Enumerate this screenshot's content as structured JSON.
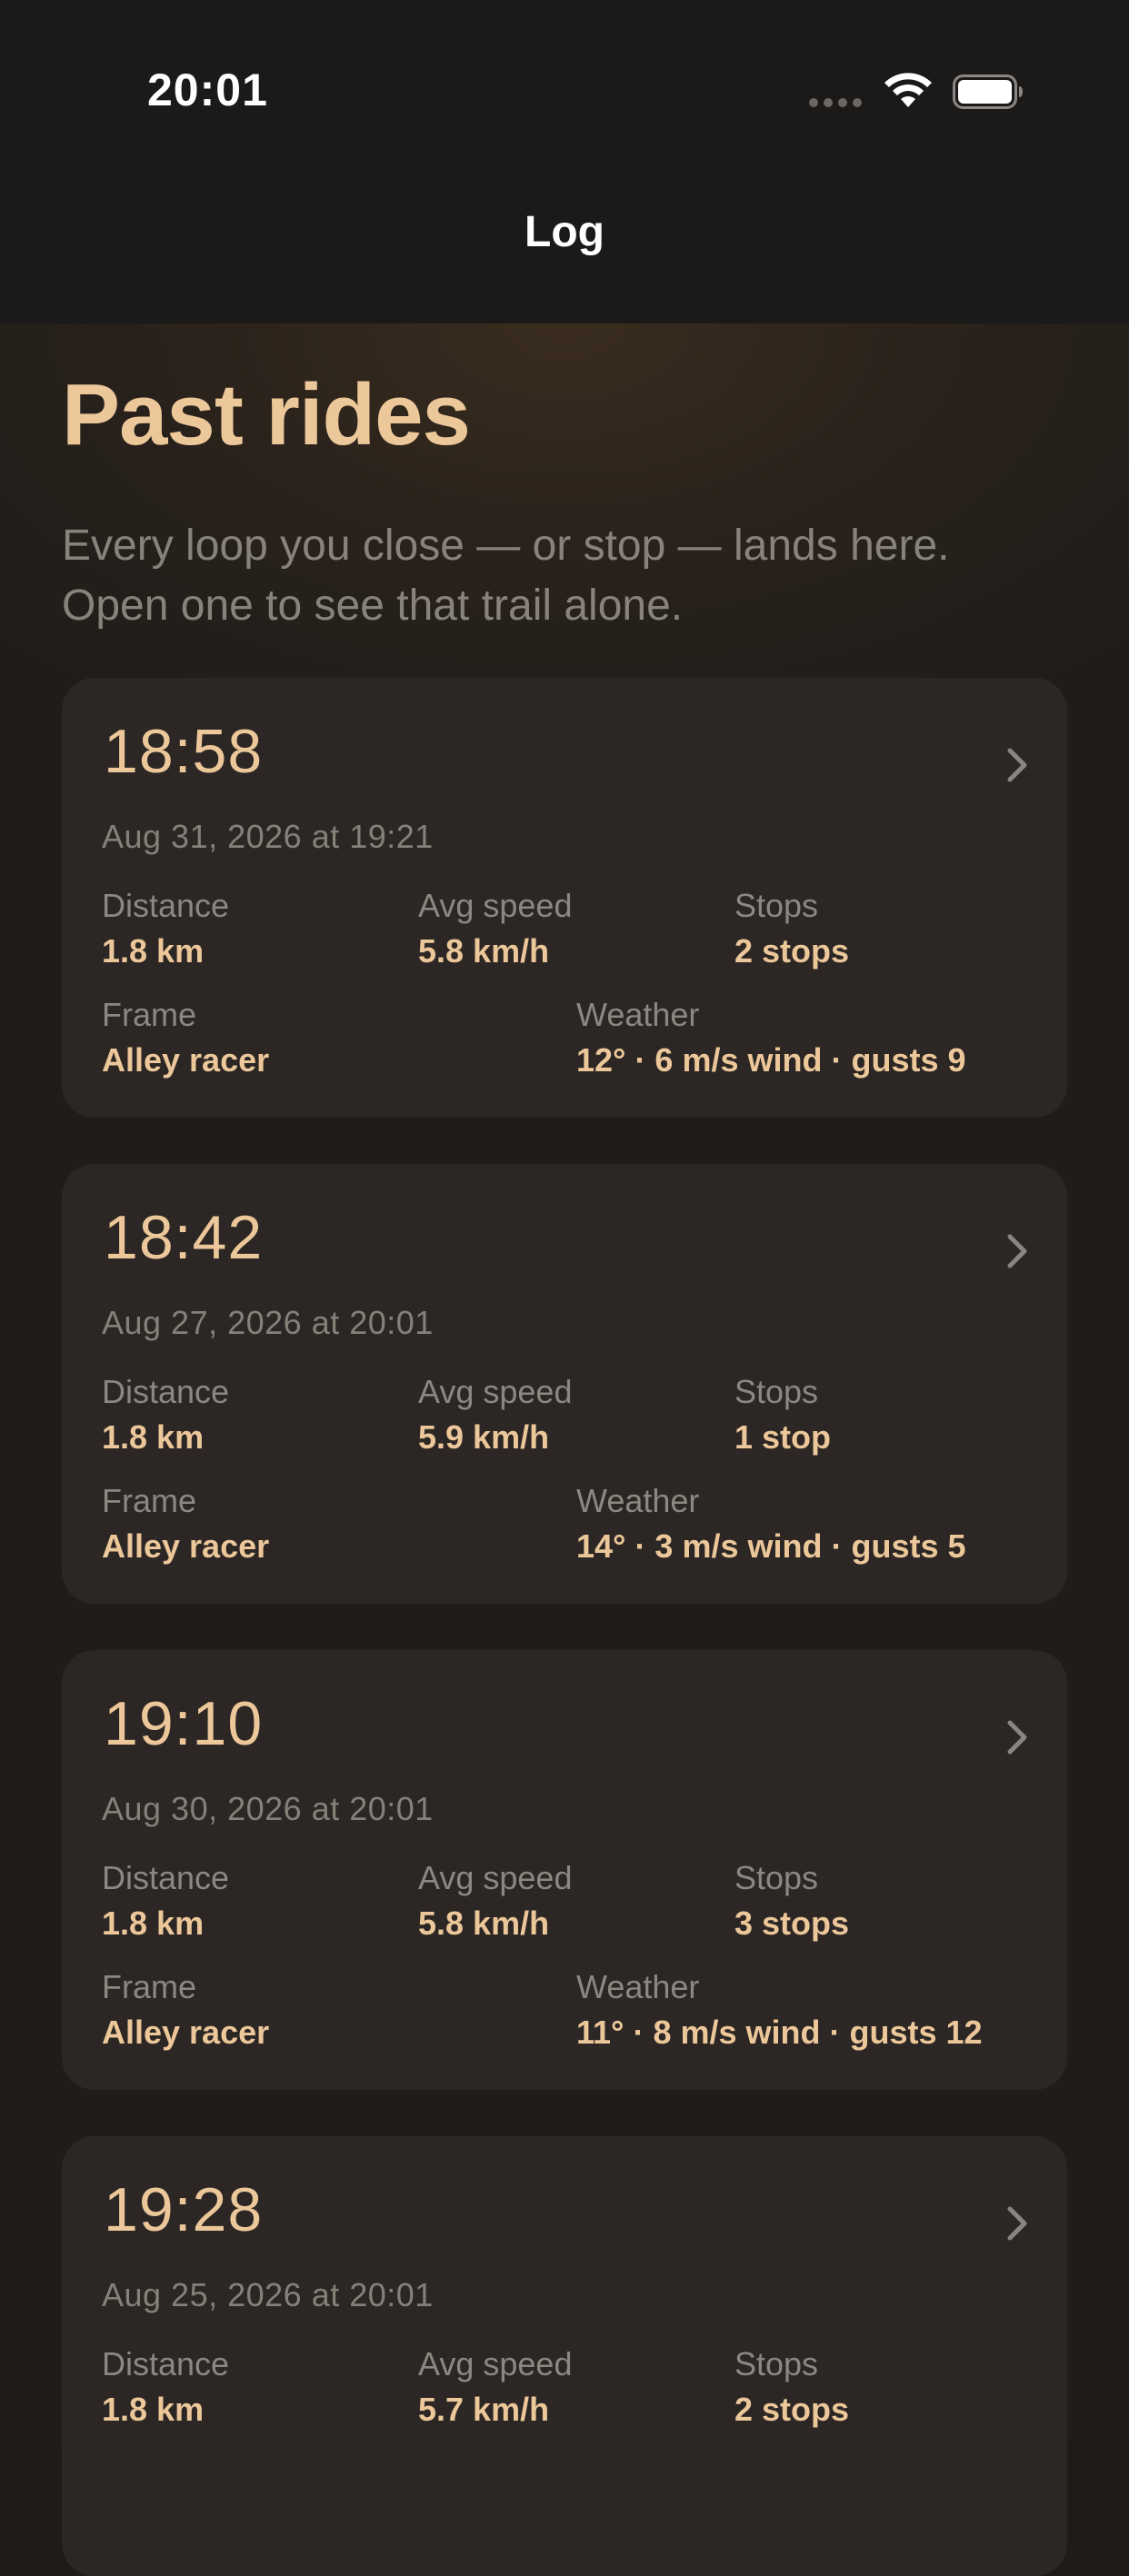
{
  "status_bar": {
    "time": "20:01",
    "signal_icon": "cellular-signal-dots-icon",
    "wifi_icon": "wifi-icon",
    "battery_icon": "battery-icon"
  },
  "nav": {
    "title": "Log"
  },
  "page": {
    "title": "Past rides",
    "subtitle_line1": "Every loop you close — or stop — lands here.",
    "subtitle_line2": "Open one to see that trail alone."
  },
  "labels": {
    "distance": "Distance",
    "avg_speed": "Avg speed",
    "stops": "Stops",
    "frame": "Frame",
    "weather": "Weather"
  },
  "rides": [
    {
      "duration": "18:58",
      "date": "Aug 31, 2026 at 19:21",
      "distance": "1.8 km",
      "avg_speed": "5.8 km/h",
      "stops": "2 stops",
      "frame": "Alley racer",
      "weather": "12° · 6 m/s wind · gusts 9"
    },
    {
      "duration": "18:42",
      "date": "Aug 27, 2026 at 20:01",
      "distance": "1.8 km",
      "avg_speed": "5.9 km/h",
      "stops": "1 stop",
      "frame": "Alley racer",
      "weather": "14° · 3 m/s wind · gusts 5"
    },
    {
      "duration": "19:10",
      "date": "Aug 30, 2026 at 20:01",
      "distance": "1.8 km",
      "avg_speed": "5.8 km/h",
      "stops": "3 stops",
      "frame": "Alley racer",
      "weather": "11° · 8 m/s wind · gusts 12"
    },
    {
      "duration": "19:28",
      "date": "Aug 25, 2026 at 20:01",
      "distance": "1.8 km",
      "avg_speed": "5.7 km/h",
      "stops": "2 stops"
    }
  ],
  "colors": {
    "accent": "#ecc79a",
    "muted_text": "#87827b",
    "card_background": "#2c2724",
    "page_background": "#1e1b19"
  }
}
